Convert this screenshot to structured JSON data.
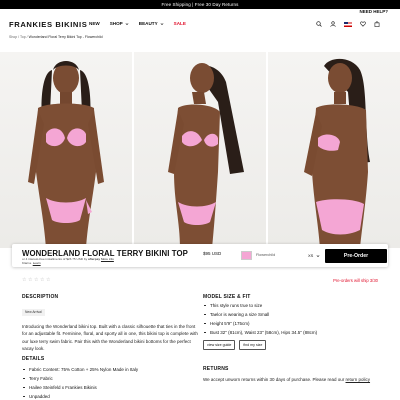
{
  "promo": {
    "text": "Free Shipping | Free 30 Day Returns"
  },
  "header": {
    "need_help": "NEED HELP?",
    "logo": "FRANKIES BIKINIS",
    "nav": [
      {
        "label": "NEW",
        "has_chevron": false
      },
      {
        "label": "SHOP",
        "has_chevron": true
      },
      {
        "label": "BEAUTY",
        "has_chevron": true
      },
      {
        "label": "SALE",
        "has_chevron": false
      }
    ],
    "icons": [
      "search-icon",
      "account-icon",
      "us-flag-icon",
      "wishlist-icon",
      "bag-icon"
    ]
  },
  "breadcrumb": {
    "path": "Shop / Top /",
    "current": "Wonderland Floral Terry Bikini Top - Flowerchild"
  },
  "gallery": {
    "photos": [
      "model-front-photo",
      "model-side-photo",
      "model-back-photo"
    ]
  },
  "product": {
    "title": "WONDERLAND FLORAL TERRY BIKINI TOP",
    "price": "$95 USD",
    "afterpay_prefix": "or 4 interest-free installments of $23.75 USD by",
    "afterpay_brand": "afterpay",
    "afterpay_link": "More info",
    "afterpay_line2": "Klarna.",
    "afterpay_link2": "Learn",
    "color_name": "Flowerchild",
    "color_hex": "#f4a6d4",
    "size": "XS",
    "cta": "Pre-Order",
    "ship_note": "Pre-orders will ship 3/30"
  },
  "description": {
    "heading": "DESCRIPTION",
    "badge": "New Arrival",
    "text": "Introducing the Wonderland bikini top. Built with a classic silhouette that ties in the front for an adjustable fit. Feminine, floral, and sporty all in one, this bikini top is complete with our luxe terry swim fabric. Pair this with the Wonderland bikini bottoms for the perfect vacay look."
  },
  "details": {
    "heading": "DETAILS",
    "items": [
      "Fabric Content: 75% Cotton + 25% Nylon Made in Italy",
      "Terry Fabric",
      "Hailee Steinfeld x Frankies Bikinis",
      "Unpadded"
    ]
  },
  "model": {
    "heading": "MODEL SIZE & FIT",
    "items": [
      "This style runs true to size",
      "Taelor is wearing a size Small",
      "Height 5'9\" (175cm)",
      "Bust 32\" (81cm), Waist 23\" (58cm), Hips 34.5\" (88cm)"
    ],
    "buttons": [
      "view size guide",
      "find my size"
    ]
  },
  "returns": {
    "heading": "RETURNS",
    "text": "We accept unworn returns within 30 days of purchase. Please read our",
    "link": "return policy"
  }
}
